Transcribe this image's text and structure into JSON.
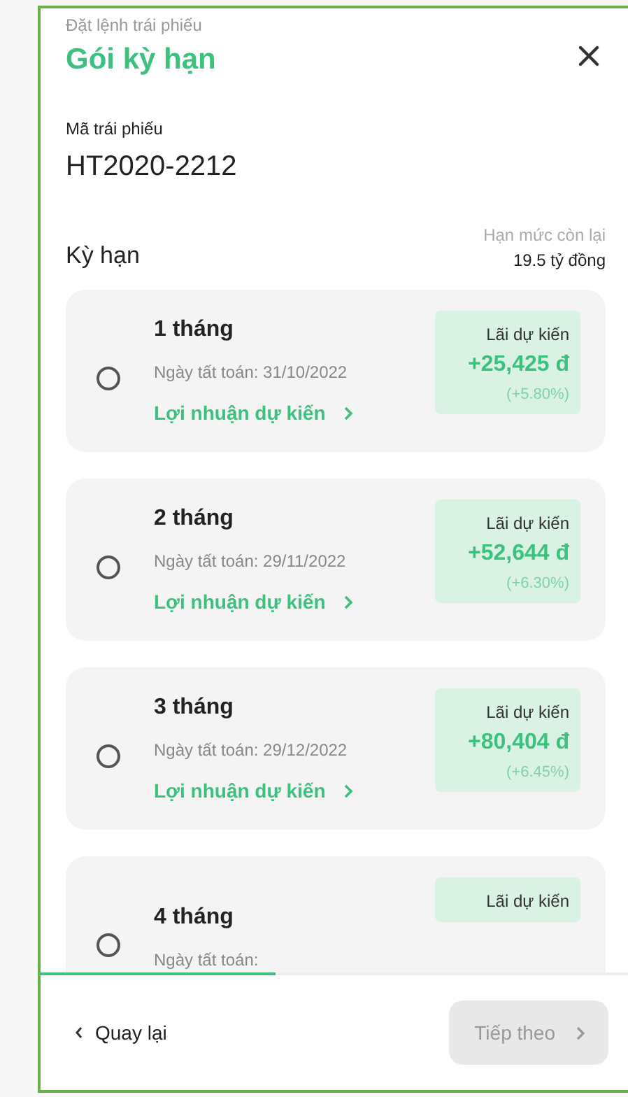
{
  "header": {
    "subtitle": "Đặt lệnh trái phiếu",
    "title": "Gói kỳ hạn"
  },
  "bond": {
    "label": "Mã trái phiếu",
    "code": "HT2020-2212"
  },
  "term_section": {
    "title": "Kỳ hạn",
    "limit_label": "Hạn mức còn lại",
    "limit_value": "19.5 tỷ đồng"
  },
  "packages": [
    {
      "term": "1 tháng",
      "selected": false,
      "settlement": "Ngày tất toán: 31/10/2022",
      "profit_link": "Lợi nhuận dự kiến",
      "interest_label": "Lãi dự kiến",
      "interest": "+25,425 đ",
      "rate": "(+5.80%)"
    },
    {
      "term": "2 tháng",
      "selected": false,
      "settlement": "Ngày tất toán: 29/11/2022",
      "profit_link": "Lợi nhuận dự kiến",
      "interest_label": "Lãi dự kiến",
      "interest": "+52,644 đ",
      "rate": "(+6.30%)"
    },
    {
      "term": "3 tháng",
      "selected": false,
      "settlement": "Ngày tất toán: 29/12/2022",
      "profit_link": "Lợi nhuận dự kiến",
      "interest_label": "Lãi dự kiến",
      "interest": "+80,404 đ",
      "rate": "(+6.45%)"
    },
    {
      "term": "4 tháng",
      "selected": false,
      "settlement": "Ngày tất toán:",
      "interest_label": "Lãi dự kiến"
    }
  ],
  "progress": {
    "level": 0.4
  },
  "footer": {
    "back": "Quay lại",
    "next": "Tiếp theo",
    "next_disabled": true
  }
}
